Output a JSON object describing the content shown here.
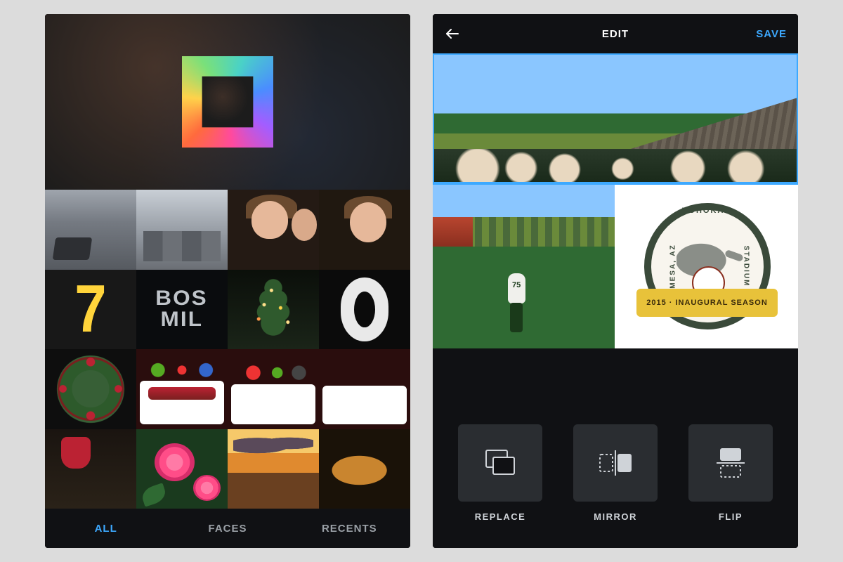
{
  "colors": {
    "accent": "#3da9ff"
  },
  "picker": {
    "tabs": [
      {
        "label": "ALL",
        "active": true
      },
      {
        "label": "FACES",
        "active": false
      },
      {
        "label": "RECENTS",
        "active": false
      }
    ],
    "jersey": {
      "big_number": "7",
      "top_text": "BOS",
      "bottom_text": "MIL"
    }
  },
  "editor": {
    "title": "EDIT",
    "save_label": "SAVE",
    "player_number": "75",
    "badge": {
      "top_arc": "HOHOKAM",
      "right_arc": "STADIUM",
      "left_arc": "MESA, AZ",
      "banner": "2015 · INAUGURAL SEASON"
    },
    "tools": [
      {
        "id": "replace",
        "label": "REPLACE"
      },
      {
        "id": "mirror",
        "label": "MIRROR"
      },
      {
        "id": "flip",
        "label": "FLIP"
      }
    ]
  }
}
